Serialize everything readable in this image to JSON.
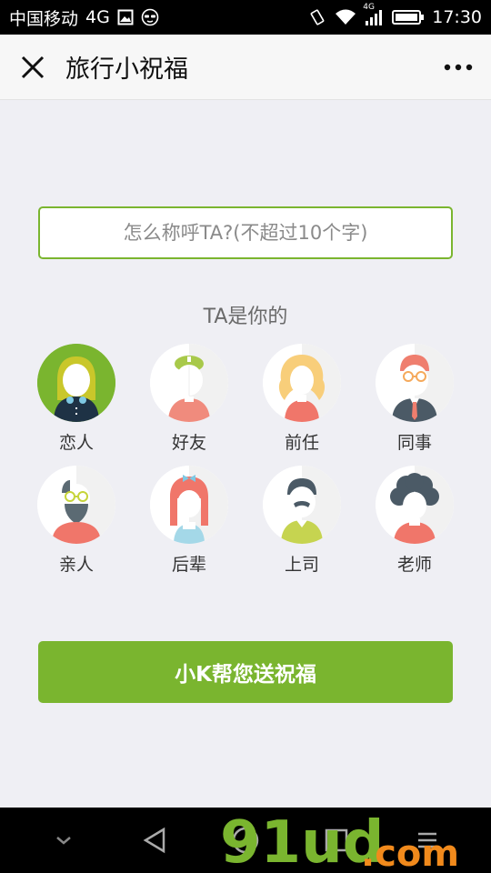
{
  "status_bar": {
    "carrier": "中国移动",
    "network": "4G",
    "network_small": "4G",
    "time": "17:30"
  },
  "header": {
    "title": "旅行小祝福",
    "close_icon": "close-icon",
    "more_icon": "more-icon"
  },
  "form": {
    "name_placeholder": "怎么称呼TA?(不超过10个字)",
    "name_value": "",
    "relation_prompt": "TA是你的",
    "roles": [
      {
        "label": "恋人",
        "icon": "lover-avatar-icon",
        "selected": true
      },
      {
        "label": "好友",
        "icon": "friend-avatar-icon",
        "selected": false
      },
      {
        "label": "前任",
        "icon": "ex-avatar-icon",
        "selected": false
      },
      {
        "label": "同事",
        "icon": "colleague-avatar-icon",
        "selected": false
      },
      {
        "label": "亲人",
        "icon": "relative-avatar-icon",
        "selected": false
      },
      {
        "label": "后辈",
        "icon": "junior-avatar-icon",
        "selected": false
      },
      {
        "label": "上司",
        "icon": "boss-avatar-icon",
        "selected": false
      },
      {
        "label": "老师",
        "icon": "teacher-avatar-icon",
        "selected": false
      }
    ],
    "submit_label": "小K帮您送祝福"
  },
  "colors": {
    "accent": "#7ab52f",
    "background": "#efeff4"
  },
  "watermark": {
    "text": "91ud.com"
  }
}
